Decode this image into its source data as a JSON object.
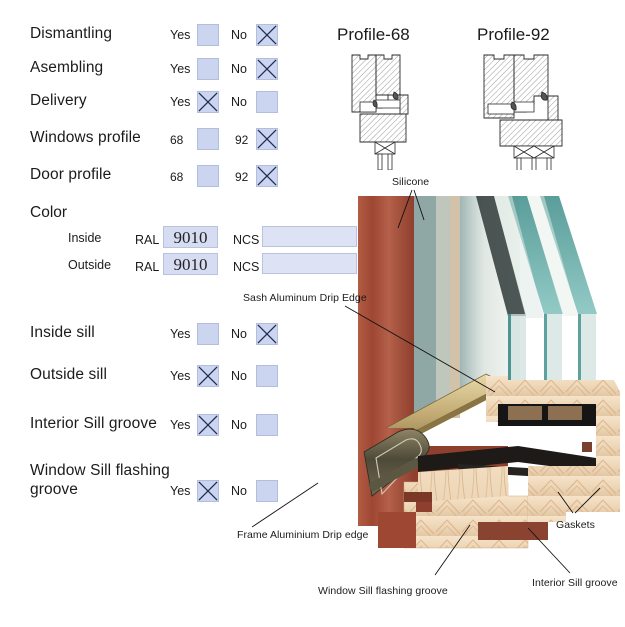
{
  "form": {
    "rows": [
      {
        "label": "Dismantling",
        "opt_a": "Yes",
        "opt_b": "No",
        "checked": "b"
      },
      {
        "label": "Asembling",
        "opt_a": "Yes",
        "opt_b": "No",
        "checked": "b"
      },
      {
        "label": "Delivery",
        "opt_a": "Yes",
        "opt_b": "No",
        "checked": "a"
      },
      {
        "label": "Windows profile",
        "opt_a": "68",
        "opt_b": "92",
        "checked": "b"
      },
      {
        "label": "Door profile",
        "opt_a": "68",
        "opt_b": "92",
        "checked": "b"
      }
    ],
    "rows2": [
      {
        "label": "Inside sill",
        "opt_a": "Yes",
        "opt_b": "No",
        "checked": "b"
      },
      {
        "label": "Outside sill",
        "opt_a": "Yes",
        "opt_b": "No",
        "checked": "a"
      },
      {
        "label": "Interior Sill groove",
        "opt_a": "Yes",
        "opt_b": "No",
        "checked": "a"
      },
      {
        "label": "Window Sill flashing groove",
        "opt_a": "Yes",
        "opt_b": "No",
        "checked": "a"
      }
    ]
  },
  "color": {
    "title": "Color",
    "inside_label": "Inside",
    "outside_label": "Outside",
    "ral_label": "RAL",
    "ncs_label": "NCS",
    "inside_ral_value": "9010",
    "outside_ral_value": "9010",
    "inside_ncs_value": "",
    "outside_ncs_value": ""
  },
  "profiles": {
    "left_title": "Profile-68",
    "right_title": "Profile-92"
  },
  "callouts": {
    "silicone": "Silicone",
    "sash_drip_edge": "Sash Aluminum Drip Edge",
    "frame_drip_edge": "Frame Aluminium Drip edge",
    "window_sill_flashing_groove": "Window Sill flashing groove",
    "gaskets": "Gaskets",
    "interior_sill_groove": "Interior Sill groove"
  },
  "colors": {
    "checkbox_fill": "#ccd5ef",
    "field_fill": "#d6ddf2",
    "x_mark": "#1f2d55",
    "frame_outside": "#a2503c",
    "wood_light": "#f2ddc3",
    "glass_teal": "#4f9a96"
  }
}
